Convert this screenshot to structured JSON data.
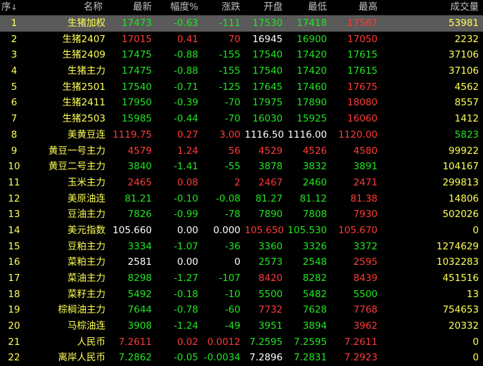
{
  "columns": [
    "序",
    "名称",
    "最新",
    "幅度%",
    "涨跌",
    "开盘",
    "最低",
    "最高",
    "成交量"
  ],
  "sort_arrow": "↓",
  "colors": {
    "up": "#ff3a3a",
    "down": "#22e522",
    "flat": "#ffffff",
    "name": "#ffff55"
  },
  "rows": [
    {
      "idx": "1",
      "name": "生猪加权",
      "last": "17473",
      "pct": "-0.63",
      "chg": "-111",
      "open": "17530",
      "low": "17418",
      "high": "17587",
      "vol": "53981",
      "c": [
        "g",
        "g",
        "g",
        "g",
        "g",
        "r",
        "y"
      ]
    },
    {
      "idx": "2",
      "name": "生猪2407",
      "last": "17015",
      "pct": "0.41",
      "chg": "70",
      "open": "16945",
      "low": "16900",
      "high": "17050",
      "vol": "2232",
      "c": [
        "r",
        "r",
        "r",
        "w",
        "g",
        "r",
        "y"
      ]
    },
    {
      "idx": "3",
      "name": "生猪2409",
      "last": "17475",
      "pct": "-0.88",
      "chg": "-155",
      "open": "17540",
      "low": "17420",
      "high": "17615",
      "vol": "37106",
      "c": [
        "g",
        "g",
        "g",
        "g",
        "g",
        "g",
        "y"
      ]
    },
    {
      "idx": "4",
      "name": "生猪主力",
      "last": "17475",
      "pct": "-0.88",
      "chg": "-155",
      "open": "17540",
      "low": "17420",
      "high": "17615",
      "vol": "37106",
      "c": [
        "g",
        "g",
        "g",
        "g",
        "g",
        "g",
        "y"
      ]
    },
    {
      "idx": "5",
      "name": "生猪2501",
      "last": "17540",
      "pct": "-0.71",
      "chg": "-125",
      "open": "17645",
      "low": "17460",
      "high": "17675",
      "vol": "4562",
      "c": [
        "g",
        "g",
        "g",
        "g",
        "g",
        "r",
        "y"
      ]
    },
    {
      "idx": "6",
      "name": "生猪2411",
      "last": "17950",
      "pct": "-0.39",
      "chg": "-70",
      "open": "17975",
      "low": "17890",
      "high": "18080",
      "vol": "8557",
      "c": [
        "g",
        "g",
        "g",
        "g",
        "g",
        "r",
        "y"
      ]
    },
    {
      "idx": "7",
      "name": "生猪2503",
      "last": "15985",
      "pct": "-0.44",
      "chg": "-70",
      "open": "16030",
      "low": "15925",
      "high": "16060",
      "vol": "1412",
      "c": [
        "g",
        "g",
        "g",
        "g",
        "g",
        "r",
        "y"
      ]
    },
    {
      "idx": "8",
      "name": "美黄豆连",
      "last": "1119.75",
      "pct": "0.27",
      "chg": "3.00",
      "open": "1116.50",
      "low": "1116.00",
      "high": "1120.00",
      "vol": "5823",
      "c": [
        "r",
        "r",
        "r",
        "w",
        "w",
        "r",
        "g"
      ]
    },
    {
      "idx": "9",
      "name": "黄豆一号主力",
      "last": "4579",
      "pct": "1.24",
      "chg": "56",
      "open": "4529",
      "low": "4526",
      "high": "4580",
      "vol": "99922",
      "c": [
        "r",
        "r",
        "r",
        "r",
        "r",
        "r",
        "y"
      ]
    },
    {
      "idx": "10",
      "name": "黄豆二号主力",
      "last": "3840",
      "pct": "-1.41",
      "chg": "-55",
      "open": "3878",
      "low": "3832",
      "high": "3891",
      "vol": "104167",
      "c": [
        "g",
        "g",
        "g",
        "g",
        "g",
        "g",
        "y"
      ]
    },
    {
      "idx": "11",
      "name": "玉米主力",
      "last": "2465",
      "pct": "0.08",
      "chg": "2",
      "open": "2467",
      "low": "2460",
      "high": "2471",
      "vol": "299813",
      "c": [
        "r",
        "r",
        "r",
        "r",
        "g",
        "r",
        "y"
      ]
    },
    {
      "idx": "12",
      "name": "美原油连",
      "last": "81.21",
      "pct": "-0.10",
      "chg": "-0.08",
      "open": "81.27",
      "low": "81.12",
      "high": "81.38",
      "vol": "14806",
      "c": [
        "g",
        "g",
        "g",
        "g",
        "g",
        "r",
        "y"
      ]
    },
    {
      "idx": "13",
      "name": "豆油主力",
      "last": "7826",
      "pct": "-0.99",
      "chg": "-78",
      "open": "7890",
      "low": "7808",
      "high": "7930",
      "vol": "502026",
      "c": [
        "g",
        "g",
        "g",
        "g",
        "g",
        "r",
        "y"
      ]
    },
    {
      "idx": "14",
      "name": "美元指数",
      "last": "105.660",
      "pct": "0.00",
      "chg": "0.000",
      "open": "105.650",
      "low": "105.530",
      "high": "105.670",
      "vol": "0",
      "c": [
        "w",
        "w",
        "w",
        "r",
        "g",
        "r",
        "y"
      ]
    },
    {
      "idx": "15",
      "name": "豆粕主力",
      "last": "3334",
      "pct": "-1.07",
      "chg": "-36",
      "open": "3360",
      "low": "3326",
      "high": "3372",
      "vol": "1274629",
      "c": [
        "g",
        "g",
        "g",
        "g",
        "g",
        "g",
        "y"
      ]
    },
    {
      "idx": "16",
      "name": "菜粕主力",
      "last": "2581",
      "pct": "0.00",
      "chg": "0",
      "open": "2573",
      "low": "2548",
      "high": "2595",
      "vol": "1032283",
      "c": [
        "w",
        "w",
        "w",
        "g",
        "g",
        "r",
        "y"
      ]
    },
    {
      "idx": "17",
      "name": "菜油主力",
      "last": "8298",
      "pct": "-1.27",
      "chg": "-107",
      "open": "8420",
      "low": "8282",
      "high": "8439",
      "vol": "451516",
      "c": [
        "g",
        "g",
        "g",
        "r",
        "g",
        "r",
        "y"
      ]
    },
    {
      "idx": "18",
      "name": "菜籽主力",
      "last": "5492",
      "pct": "-0.18",
      "chg": "-10",
      "open": "5500",
      "low": "5482",
      "high": "5500",
      "vol": "13",
      "c": [
        "g",
        "g",
        "g",
        "g",
        "g",
        "g",
        "y"
      ]
    },
    {
      "idx": "19",
      "name": "棕榈油主力",
      "last": "7644",
      "pct": "-0.78",
      "chg": "-60",
      "open": "7732",
      "low": "7628",
      "high": "7768",
      "vol": "754653",
      "c": [
        "g",
        "g",
        "g",
        "r",
        "g",
        "r",
        "y"
      ]
    },
    {
      "idx": "20",
      "name": "马棕油连",
      "last": "3908",
      "pct": "-1.24",
      "chg": "-49",
      "open": "3951",
      "low": "3894",
      "high": "3962",
      "vol": "20332",
      "c": [
        "g",
        "g",
        "g",
        "g",
        "g",
        "r",
        "y"
      ]
    },
    {
      "idx": "21",
      "name": "人民币",
      "last": "7.2611",
      "pct": "0.02",
      "chg": "0.0012",
      "open": "7.2595",
      "low": "7.2595",
      "high": "7.2611",
      "vol": "0",
      "c": [
        "r",
        "r",
        "r",
        "g",
        "g",
        "r",
        "y"
      ]
    },
    {
      "idx": "22",
      "name": "离岸人民币",
      "last": "7.2862",
      "pct": "-0.05",
      "chg": "-0.0034",
      "open": "7.2896",
      "low": "7.2831",
      "high": "7.2923",
      "vol": "0",
      "c": [
        "g",
        "g",
        "g",
        "w",
        "g",
        "r",
        "y"
      ]
    }
  ]
}
